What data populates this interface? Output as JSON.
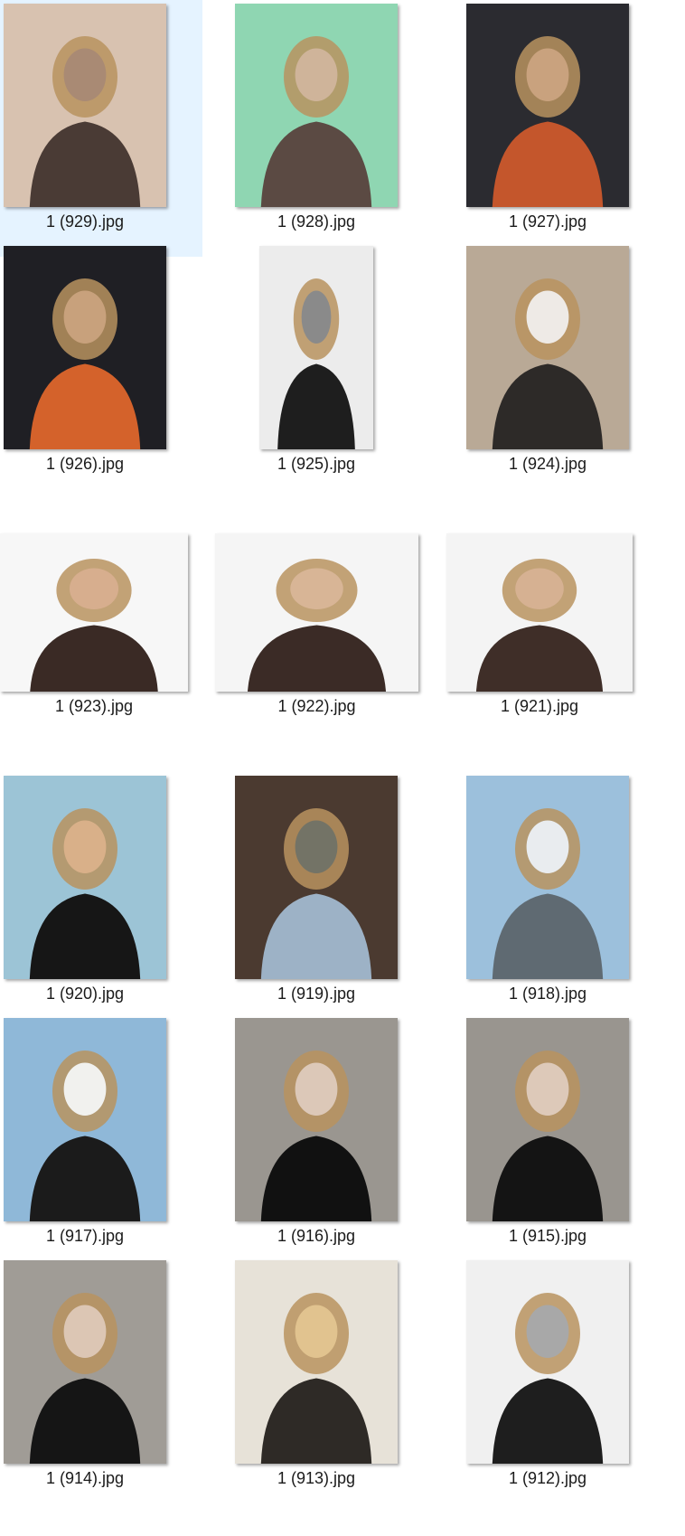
{
  "explorer": {
    "view": "Large icons",
    "files": [
      {
        "name": "1 (929).jpg",
        "selected": true,
        "icon": "photo-thumbnail-icon",
        "tone": [
          "#d8c2b0",
          "#a98a74",
          "#4a3b35"
        ]
      },
      {
        "name": "1 (928).jpg",
        "selected": false,
        "icon": "photo-thumbnail-icon",
        "tone": [
          "#8fd6b2",
          "#cfb49a",
          "#5b4a43"
        ]
      },
      {
        "name": "1 (927).jpg",
        "selected": false,
        "icon": "photo-thumbnail-icon",
        "tone": [
          "#2b2b30",
          "#c9a27e",
          "#c4562c"
        ]
      },
      {
        "name": "1 (926).jpg",
        "selected": false,
        "icon": "photo-thumbnail-icon",
        "tone": [
          "#1f1f24",
          "#c8a17c",
          "#d4622b"
        ]
      },
      {
        "name": "1 (925).jpg",
        "selected": false,
        "icon": "photo-thumbnail-icon",
        "tone": [
          "#ececec",
          "#8a8a8a",
          "#1e1e1e"
        ]
      },
      {
        "name": "1 (924).jpg",
        "selected": false,
        "icon": "photo-thumbnail-icon",
        "tone": [
          "#b9a996",
          "#eeeae6",
          "#2d2a28"
        ]
      },
      {
        "name": "1 (923).jpg",
        "selected": false,
        "icon": "photo-thumbnail-icon",
        "tone": [
          "#f7f7f7",
          "#d7ae8e",
          "#3a2a25"
        ]
      },
      {
        "name": "1 (922).jpg",
        "selected": false,
        "icon": "photo-thumbnail-icon",
        "tone": [
          "#f5f5f5",
          "#d8b596",
          "#3b2b26"
        ]
      },
      {
        "name": "1 (921).jpg",
        "selected": false,
        "icon": "photo-thumbnail-icon",
        "tone": [
          "#f4f4f4",
          "#d6b192",
          "#3f2e28"
        ]
      },
      {
        "name": "1 (920).jpg",
        "selected": false,
        "icon": "photo-thumbnail-icon",
        "tone": [
          "#9cc4d6",
          "#d9b089",
          "#161616"
        ]
      },
      {
        "name": "1 (919).jpg",
        "selected": false,
        "icon": "photo-thumbnail-icon",
        "tone": [
          "#4b3a30",
          "#737366",
          "#9db2c6"
        ]
      },
      {
        "name": "1 (918).jpg",
        "selected": false,
        "icon": "photo-thumbnail-icon",
        "tone": [
          "#9cc0dc",
          "#e9ecef",
          "#5f6a72"
        ]
      },
      {
        "name": "1 (917).jpg",
        "selected": false,
        "icon": "photo-thumbnail-icon",
        "tone": [
          "#8fb8d8",
          "#f1f1ee",
          "#1b1b1b"
        ]
      },
      {
        "name": "1 (916).jpg",
        "selected": false,
        "icon": "photo-thumbnail-icon",
        "tone": [
          "#9a9690",
          "#dcc8b8",
          "#111111"
        ]
      },
      {
        "name": "1 (915).jpg",
        "selected": false,
        "icon": "photo-thumbnail-icon",
        "tone": [
          "#99958f",
          "#ddc9b9",
          "#141414"
        ]
      },
      {
        "name": "1 (914).jpg",
        "selected": false,
        "icon": "photo-thumbnail-icon",
        "tone": [
          "#a09c96",
          "#dcc6b4",
          "#151515"
        ]
      },
      {
        "name": "1 (913).jpg",
        "selected": false,
        "icon": "photo-thumbnail-icon",
        "tone": [
          "#e7e2d8",
          "#e1c38f",
          "#2e2a26"
        ]
      },
      {
        "name": "1 (912).jpg",
        "selected": false,
        "icon": "photo-thumbnail-icon",
        "tone": [
          "#f0f0f0",
          "#a8a8a8",
          "#1e1e1e"
        ]
      }
    ]
  }
}
